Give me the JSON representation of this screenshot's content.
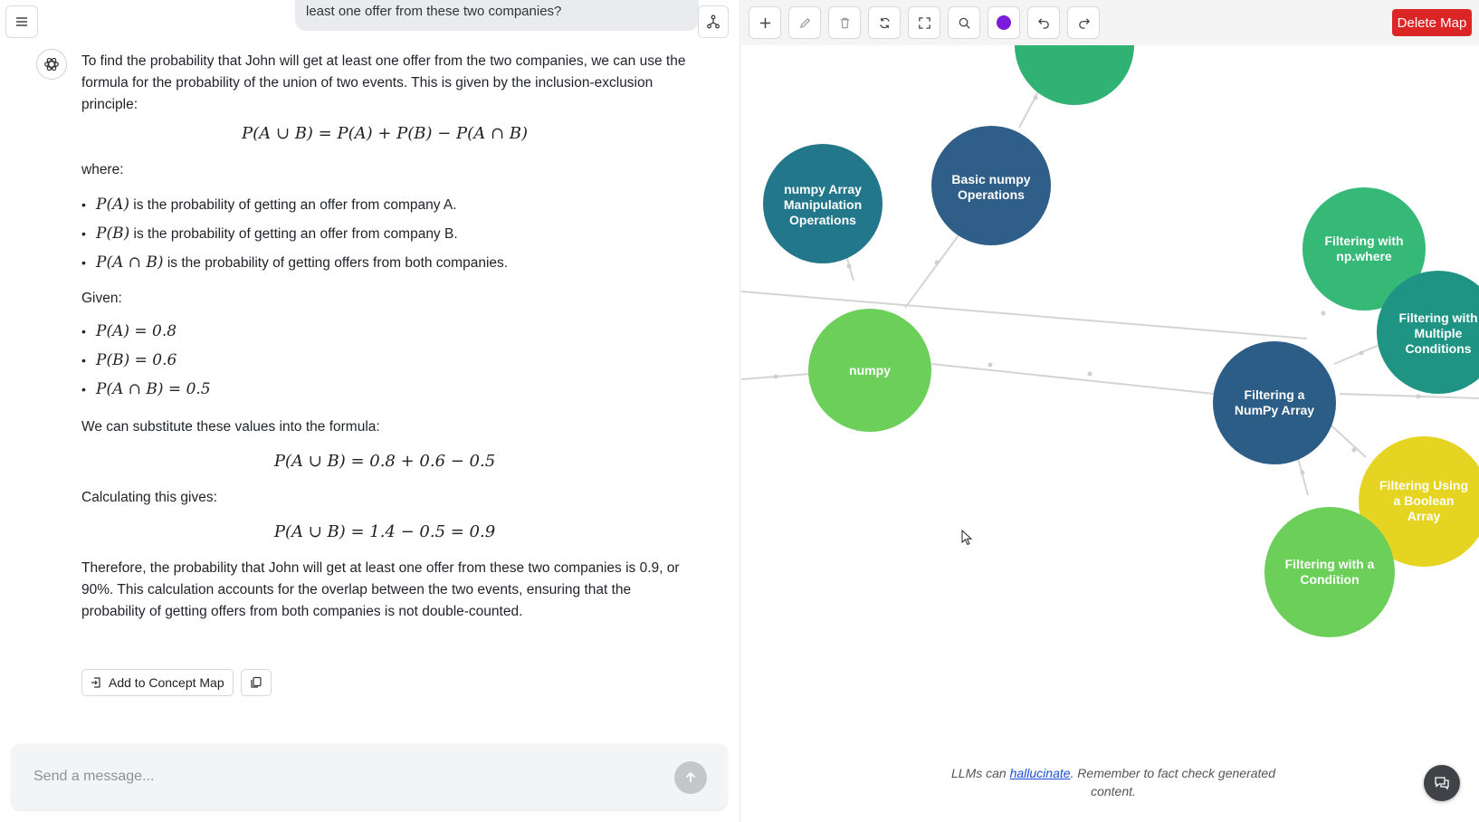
{
  "chat": {
    "user_message": "least one offer from these two companies?",
    "intro": "To find the probability that John will get at least one offer from the two companies, we can use the formula for the probability of the union of two events. This is given by the inclusion-exclusion principle:",
    "formula_union": "P(A ∪ B) = P(A) + P(B) − P(A ∩ B)",
    "where_label": "where:",
    "definitions": [
      {
        "expr": "P(A)",
        "text": " is the probability of getting an offer from company A."
      },
      {
        "expr": "P(B)",
        "text": " is the probability of getting an offer from company B."
      },
      {
        "expr": "P(A ∩ B)",
        "text": " is the probability of getting offers from both companies."
      }
    ],
    "given_label": "Given:",
    "given": [
      "P(A) = 0.8",
      "P(B) = 0.6",
      "P(A ∩ B) = 0.5"
    ],
    "substitute_text": "We can substitute these values into the formula:",
    "formula_substituted": "P(A ∪ B) = 0.8 + 0.6 − 0.5",
    "calculating_text": "Calculating this gives:",
    "formula_result": "P(A ∪ B) = 1.4 − 0.5 = 0.9",
    "conclusion": "Therefore, the probability that John will get at least one offer from these two companies is 0.9, or 90%. This calculation accounts for the overlap between the two events, ensuring that the probability of getting offers from both companies is not double-counted.",
    "add_to_map_label": "Add to Concept Map",
    "composer_placeholder": "Send a message..."
  },
  "toolbar": {
    "delete_map_label": "Delete Map",
    "selected_color": "#7c1bd9",
    "delete_color": "#dc2626",
    "tools": [
      "add-icon",
      "edit-icon",
      "trash-icon",
      "refresh-icon",
      "fullscreen-icon",
      "search-icon",
      "color-picker",
      "undo-icon",
      "redo-icon"
    ]
  },
  "concept_map": {
    "nodes": [
      {
        "id": "top",
        "label": "",
        "color": "#2fb273"
      },
      {
        "id": "basic",
        "label": "Basic numpy Operations",
        "color": "#2f5f88"
      },
      {
        "id": "manip",
        "label": "numpy Array Manipulation Operations",
        "color": "#23778a"
      },
      {
        "id": "numpy",
        "label": "numpy",
        "color": "#6bcf59"
      },
      {
        "id": "npwhere",
        "label": "Filtering with np.where",
        "color": "#36b877"
      },
      {
        "id": "multi",
        "label": "Filtering with Multiple Conditions",
        "color": "#1f9484"
      },
      {
        "id": "filterarr",
        "label": "Filtering a NumPy Array",
        "color": "#2c5d86"
      },
      {
        "id": "boolean",
        "label": "Filtering Using a Boolean Array",
        "color": "#e5d421"
      },
      {
        "id": "condition",
        "label": "Filtering with a Condition",
        "color": "#6bcf59"
      }
    ]
  },
  "footer": {
    "disclaimer_before": "LLMs can ",
    "disclaimer_link": "hallucinate",
    "disclaimer_after": ". Remember to fact check generated content."
  }
}
